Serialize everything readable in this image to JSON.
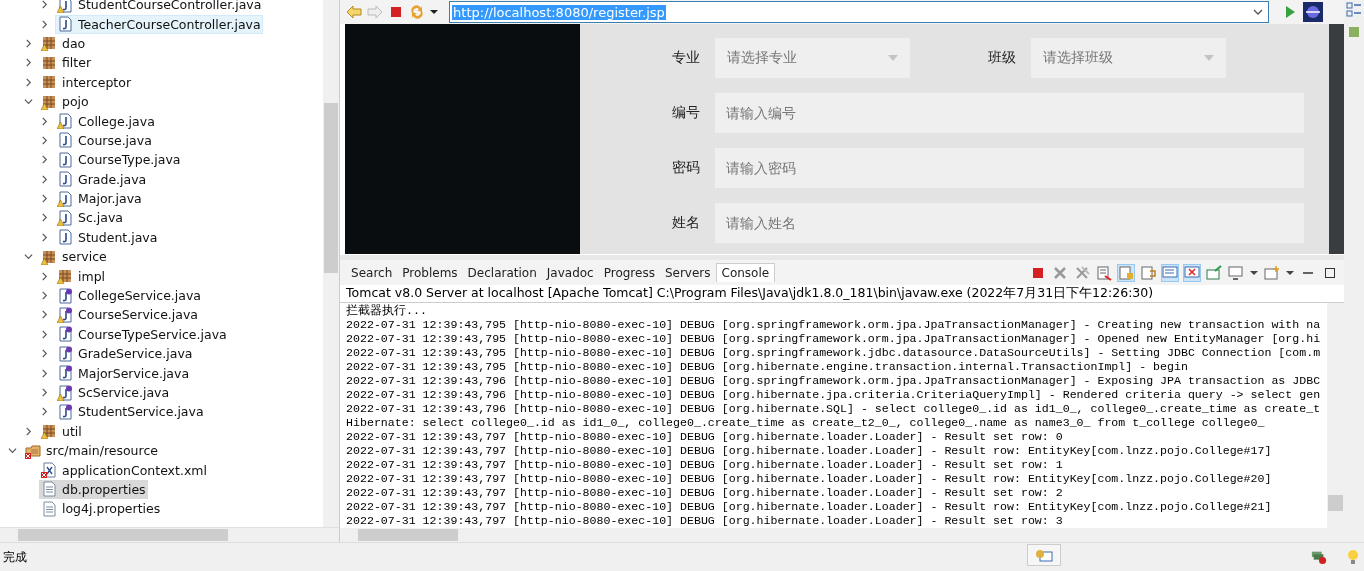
{
  "explorer": {
    "continued_items": [
      {
        "label": "StudentCourseController.java",
        "kind": "class",
        "warning": true,
        "error": false,
        "expanded": false,
        "selected": false,
        "hovered": false
      },
      {
        "label": "TeacherCourseController.java",
        "kind": "class",
        "warning": false,
        "error": false,
        "expanded": false,
        "selected": false,
        "hovered": true
      }
    ],
    "packages": [
      {
        "label": "dao",
        "kind": "package",
        "warning": true,
        "error": false,
        "expanded": false,
        "selected": false,
        "hovered": false
      },
      {
        "label": "filter",
        "kind": "package",
        "warning": false,
        "error": false,
        "expanded": false,
        "selected": false,
        "hovered": false
      },
      {
        "label": "interceptor",
        "kind": "package",
        "warning": false,
        "error": false,
        "expanded": false,
        "selected": false,
        "hovered": false
      },
      {
        "label": "pojo",
        "kind": "package",
        "warning": true,
        "error": false,
        "expanded": true,
        "selected": false,
        "hovered": false,
        "children": [
          {
            "label": "College.java",
            "kind": "class",
            "warning": true,
            "error": false,
            "expanded": false,
            "selected": false,
            "hovered": false
          },
          {
            "label": "Course.java",
            "kind": "class",
            "warning": false,
            "error": false,
            "expanded": false,
            "selected": false,
            "hovered": false
          },
          {
            "label": "CourseType.java",
            "kind": "class",
            "warning": false,
            "error": false,
            "expanded": false,
            "selected": false,
            "hovered": false
          },
          {
            "label": "Grade.java",
            "kind": "class",
            "warning": false,
            "error": false,
            "expanded": false,
            "selected": false,
            "hovered": false
          },
          {
            "label": "Major.java",
            "kind": "class",
            "warning": true,
            "error": false,
            "expanded": false,
            "selected": false,
            "hovered": false
          },
          {
            "label": "Sc.java",
            "kind": "class",
            "warning": true,
            "error": false,
            "expanded": false,
            "selected": false,
            "hovered": false
          },
          {
            "label": "Student.java",
            "kind": "class",
            "warning": false,
            "error": false,
            "expanded": false,
            "selected": false,
            "hovered": false
          }
        ]
      },
      {
        "label": "service",
        "kind": "package",
        "warning": true,
        "error": false,
        "expanded": true,
        "selected": false,
        "hovered": false,
        "children": [
          {
            "label": "impl",
            "kind": "package",
            "warning": true,
            "error": false,
            "expanded": false,
            "selected": false,
            "hovered": false
          },
          {
            "label": "CollegeService.java",
            "kind": "interface",
            "warning": false,
            "error": false,
            "expanded": false,
            "selected": false,
            "hovered": false
          },
          {
            "label": "CourseService.java",
            "kind": "interface",
            "warning": true,
            "error": false,
            "expanded": false,
            "selected": false,
            "hovered": false
          },
          {
            "label": "CourseTypeService.java",
            "kind": "interface",
            "warning": false,
            "error": false,
            "expanded": false,
            "selected": false,
            "hovered": false
          },
          {
            "label": "GradeService.java",
            "kind": "interface",
            "warning": false,
            "error": false,
            "expanded": false,
            "selected": false,
            "hovered": false
          },
          {
            "label": "MajorService.java",
            "kind": "interface",
            "warning": false,
            "error": false,
            "expanded": false,
            "selected": false,
            "hovered": false
          },
          {
            "label": "ScService.java",
            "kind": "interface",
            "warning": true,
            "error": false,
            "expanded": false,
            "selected": false,
            "hovered": false
          },
          {
            "label": "StudentService.java",
            "kind": "interface",
            "warning": false,
            "error": false,
            "expanded": false,
            "selected": false,
            "hovered": false
          }
        ]
      },
      {
        "label": "util",
        "kind": "package",
        "warning": true,
        "error": false,
        "expanded": false,
        "selected": false,
        "hovered": false
      }
    ],
    "source_folders": [
      {
        "label": "src/main/resource",
        "kind": "folder",
        "warning": false,
        "error": true,
        "expanded": true,
        "selected": false,
        "hovered": false,
        "children": [
          {
            "label": "applicationContext.xml",
            "kind": "xml",
            "warning": false,
            "error": true,
            "selected": false,
            "hovered": false
          },
          {
            "label": "db.properties",
            "kind": "file",
            "warning": false,
            "error": false,
            "selected": true,
            "hovered": false
          },
          {
            "label": "log4j.properties",
            "kind": "file",
            "warning": false,
            "error": false,
            "selected": false,
            "hovered": false
          }
        ]
      }
    ]
  },
  "browser": {
    "url": "http://localhost:8080/register.jsp",
    "selects": [
      {
        "label": "专业",
        "placeholder": "请选择专业"
      },
      {
        "label": "班级",
        "placeholder": "请选择班级"
      }
    ],
    "fields": [
      {
        "label": "编号",
        "placeholder": "请输入编号"
      },
      {
        "label": "密码",
        "placeholder": "请输入密码"
      },
      {
        "label": "姓名",
        "placeholder": "请输入姓名"
      }
    ]
  },
  "console": {
    "tabs": [
      {
        "label": "Search",
        "selected": false
      },
      {
        "label": "Problems",
        "selected": false
      },
      {
        "label": "Declaration",
        "selected": false
      },
      {
        "label": "Javadoc",
        "selected": false
      },
      {
        "label": "Progress",
        "selected": false
      },
      {
        "label": "Servers",
        "selected": false
      },
      {
        "label": "Console",
        "selected": true
      }
    ],
    "title": "Tomcat v8.0 Server at localhost [Apache Tomcat] C:\\Program Files\\Java\\jdk1.8.0_181\\bin\\javaw.exe  (2022年7月31日下午12:26:30)",
    "lines": [
      "拦截器执行...",
      "2022-07-31 12:39:43,795 [http-nio-8080-exec-10] DEBUG [org.springframework.orm.jpa.JpaTransactionManager] - Creating new transaction with na",
      "2022-07-31 12:39:43,795 [http-nio-8080-exec-10] DEBUG [org.springframework.orm.jpa.JpaTransactionManager] - Opened new EntityManager [org.hi",
      "2022-07-31 12:39:43,795 [http-nio-8080-exec-10] DEBUG [org.springframework.jdbc.datasource.DataSourceUtils] - Setting JDBC Connection [com.m",
      "2022-07-31 12:39:43,795 [http-nio-8080-exec-10] DEBUG [org.hibernate.engine.transaction.internal.TransactionImpl] - begin",
      "2022-07-31 12:39:43,796 [http-nio-8080-exec-10] DEBUG [org.springframework.orm.jpa.JpaTransactionManager] - Exposing JPA transaction as JDBC",
      "2022-07-31 12:39:43,796 [http-nio-8080-exec-10] DEBUG [org.hibernate.jpa.criteria.CriteriaQueryImpl] - Rendered criteria query -> select gen",
      "2022-07-31 12:39:43,796 [http-nio-8080-exec-10] DEBUG [org.hibernate.SQL] - select college0_.id as id1_0_, college0_.create_time as create_t",
      "Hibernate: select college0_.id as id1_0_, college0_.create_time as create_t2_0_, college0_.name as name3_0_ from t_college college0_",
      "2022-07-31 12:39:43,797 [http-nio-8080-exec-10] DEBUG [org.hibernate.loader.Loader] - Result set row: 0",
      "2022-07-31 12:39:43,797 [http-nio-8080-exec-10] DEBUG [org.hibernate.loader.Loader] - Result row: EntityKey[com.lnzz.pojo.College#17]",
      "2022-07-31 12:39:43,797 [http-nio-8080-exec-10] DEBUG [org.hibernate.loader.Loader] - Result set row: 1",
      "2022-07-31 12:39:43,797 [http-nio-8080-exec-10] DEBUG [org.hibernate.loader.Loader] - Result row: EntityKey[com.lnzz.pojo.College#20]",
      "2022-07-31 12:39:43,797 [http-nio-8080-exec-10] DEBUG [org.hibernate.loader.Loader] - Result set row: 2",
      "2022-07-31 12:39:43,797 [http-nio-8080-exec-10] DEBUG [org.hibernate.loader.Loader] - Result row: EntityKey[com.lnzz.pojo.College#21]",
      "2022-07-31 12:39:43,797 [http-nio-8080-exec-10] DEBUG [org.hibernate.loader.Loader] - Result set row: 3"
    ]
  },
  "status_bar": {
    "text": "完成"
  }
}
